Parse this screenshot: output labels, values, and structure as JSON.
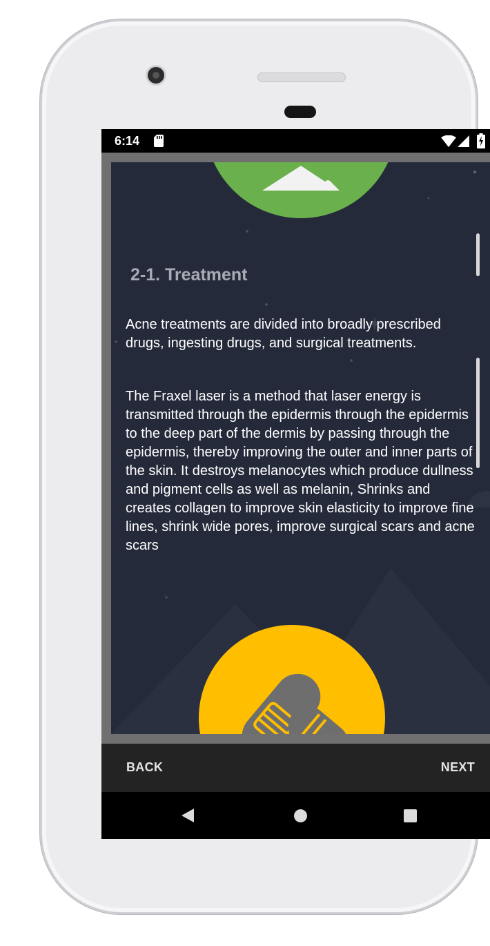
{
  "status_bar": {
    "time": "6:14",
    "icons": [
      "sd-card-icon",
      "wifi-icon",
      "signal-icon",
      "battery-charging-icon"
    ]
  },
  "article": {
    "heading": "2-1. Treatment",
    "paragraphs": [
      "Acne treatments are divided into broadly prescribed drugs, ingesting drugs, and surgical treatments.",
      "The Fraxel laser is a method that laser energy is transmitted through the epidermis through the epidermis to the deep part of the dermis by passing through the epidermis, thereby improving the outer and inner parts of the skin. It destroys melanocytes which produce dullness and pigment cells as well as melanin, Shrinks and creates collagen to improve skin elasticity to improve fine lines, shrink wide pores, improve surgical scars and acne scars"
    ]
  },
  "navigation": {
    "back_label": "BACK",
    "next_label": "NEXT"
  },
  "system_nav": {
    "buttons": [
      "back-icon",
      "home-icon",
      "recents-icon"
    ]
  },
  "colors": {
    "card_background": "#252a3a",
    "top_badge": "#6ab04c",
    "bottom_badge": "#ffbe00",
    "heading": "#a8aab4",
    "nav_bar": "#232323"
  }
}
